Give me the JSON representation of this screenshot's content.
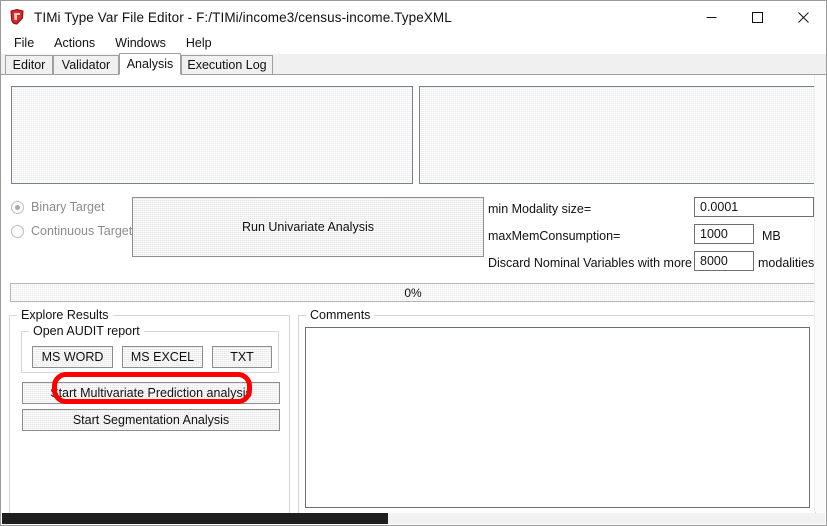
{
  "window": {
    "title": "TIMi Type Var File Editor - F:/TIMi/income3/census-income.TypeXML",
    "icon": "timi-shield-icon",
    "controls": {
      "minimize": "minimize-icon",
      "maximize": "maximize-icon",
      "close": "close-icon"
    }
  },
  "menubar": {
    "items": [
      {
        "label": "File"
      },
      {
        "label": "Actions"
      },
      {
        "label": "Windows"
      },
      {
        "label": "Help"
      }
    ]
  },
  "tabs": {
    "active": "Analysis",
    "items": [
      {
        "label": "Editor"
      },
      {
        "label": "Validator"
      },
      {
        "label": "Analysis"
      },
      {
        "label": "Execution Log"
      }
    ]
  },
  "panels": {
    "left_list": "",
    "right_list": ""
  },
  "target_type": {
    "options": [
      {
        "label": "Binary Target",
        "selected": true
      },
      {
        "label": "Continuous Target",
        "selected": false
      }
    ]
  },
  "actions": {
    "run_univariate": "Run Univariate Analysis"
  },
  "settings": {
    "min_modality": {
      "label": "min Modality size=",
      "value": "0.0001",
      "unit": ""
    },
    "max_mem": {
      "label": "maxMemConsumption=",
      "value": "1000",
      "unit": "MB"
    },
    "discard_nominal": {
      "label": "Discard Nominal Variables with more than",
      "value": "8000",
      "unit": "modalities"
    }
  },
  "progress": {
    "text": "0%",
    "value": 0
  },
  "explore_results": {
    "legend": "Explore Results",
    "audit": {
      "legend": "Open AUDIT report",
      "buttons": [
        {
          "label": "MS WORD"
        },
        {
          "label": "MS EXCEL"
        },
        {
          "label": "TXT"
        }
      ]
    },
    "multivariate_button": "Start Multivariate Prediction analysis",
    "segmentation_button": "Start Segmentation Analysis"
  },
  "comments": {
    "legend": "Comments",
    "value": "",
    "placeholder": ""
  },
  "annotation": {
    "color": "#ff0000",
    "target": "Start Multivariate Prediction analysis"
  }
}
